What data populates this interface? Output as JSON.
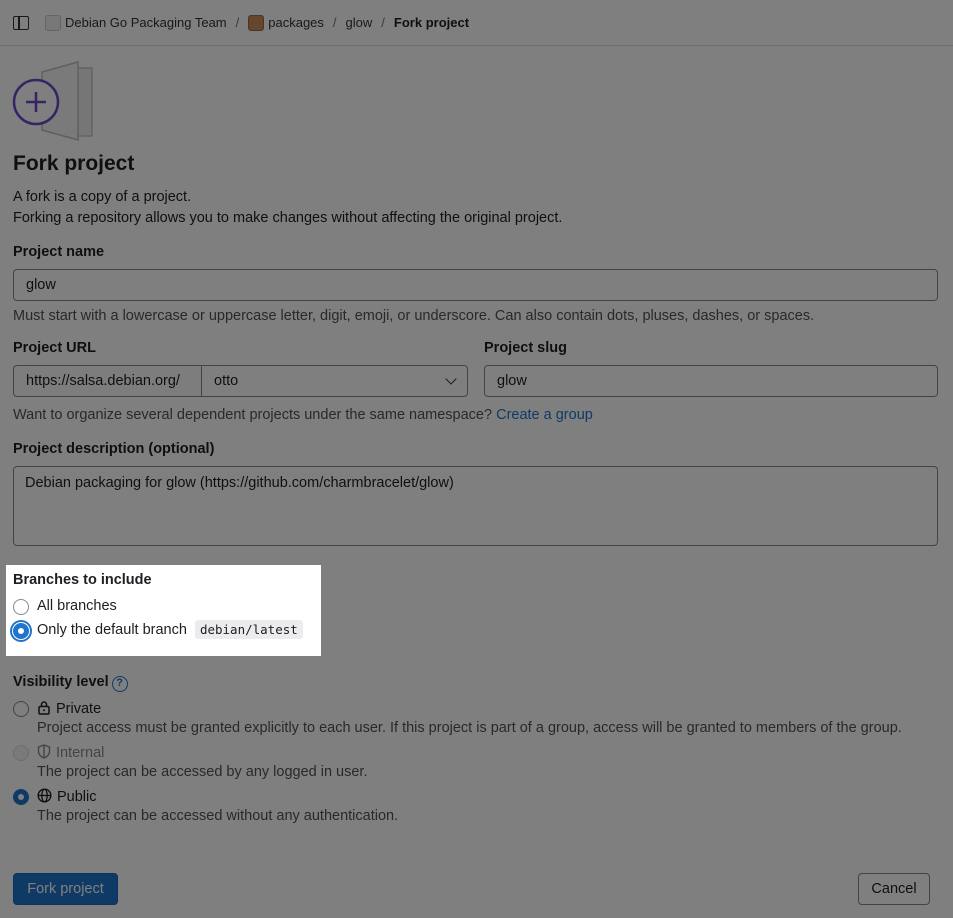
{
  "breadcrumb": {
    "items": [
      "Debian Go Packaging Team",
      "packages",
      "glow"
    ],
    "current": "Fork project"
  },
  "page": {
    "title": "Fork project",
    "desc1": "A fork is a copy of a project.",
    "desc2": "Forking a repository allows you to make changes without affecting the original project."
  },
  "project_name": {
    "label": "Project name",
    "value": "glow",
    "help": "Must start with a lowercase or uppercase letter, digit, emoji, or underscore. Can also contain dots, pluses, dashes, or spaces."
  },
  "project_url": {
    "label": "Project URL",
    "prefix": "https://salsa.debian.org/",
    "namespace": "otto"
  },
  "project_slug": {
    "label": "Project slug",
    "value": "glow"
  },
  "namespace_help": {
    "text": "Want to organize several dependent projects under the same namespace? ",
    "link": "Create a group"
  },
  "description": {
    "label": "Project description (optional)",
    "value": "Debian packaging for glow (https://github.com/charmbracelet/glow)"
  },
  "branches": {
    "label": "Branches to include",
    "all": "All branches",
    "default": "Only the default branch",
    "default_branch": "debian/latest"
  },
  "visibility": {
    "label": "Visibility level",
    "help_icon": "question-icon",
    "private": {
      "label": "Private",
      "desc": "Project access must be granted explicitly to each user. If this project is part of a group, access will be granted to members of the group."
    },
    "internal": {
      "label": "Internal",
      "desc": "The project can be accessed by any logged in user."
    },
    "public": {
      "label": "Public",
      "desc": "The project can be accessed without any authentication."
    }
  },
  "actions": {
    "submit": "Fork project",
    "cancel": "Cancel"
  },
  "colors": {
    "accent": "#1f75cb",
    "illustration": "#6e49cb"
  }
}
